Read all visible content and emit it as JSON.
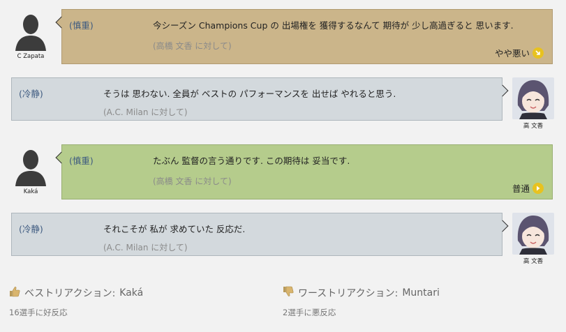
{
  "messages": [
    {
      "speaker": "C Zapata",
      "side": "left",
      "attitude": "(慎重)",
      "text": "今シーズン Champions Cup の 出場権を 獲得するなんて 期待が 少し高過ぎると 思います.",
      "target": "(高橋 文香 に対して)",
      "reaction_label": "やや悪い",
      "reaction_icon": "arrow-down-right-icon"
    },
    {
      "speaker": "高 文香",
      "side": "right",
      "attitude": "(冷静)",
      "text": "そうは 思わない. 全員が ベストの パフォーマンスを 出せば やれると思う.",
      "target": "(A.C. Milan に対して)"
    },
    {
      "speaker": "Kaká",
      "side": "left",
      "attitude": "(慎重)",
      "text": "たぶん 監督の言う通りです. この期待は 妥当です.",
      "target": "(高橋 文香 に対して)",
      "reaction_label": "普通",
      "reaction_icon": "arrow-right-icon"
    },
    {
      "speaker": "高 文香",
      "side": "right",
      "attitude": "(冷静)",
      "text": "それこそが 私が 求めていた 反応だ.",
      "target": "(A.C. Milan に対して)"
    }
  ],
  "footer": {
    "best_label": "ベストリアクション:",
    "best_name": "Kaká",
    "best_count": "16選手に好反応",
    "worst_label": "ワーストリアクション:",
    "worst_name": "Muntari",
    "worst_count": "2選手に悪反応"
  }
}
